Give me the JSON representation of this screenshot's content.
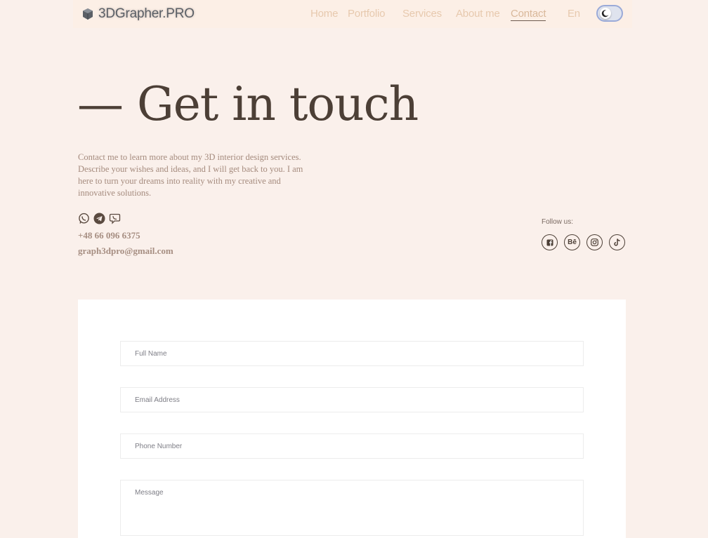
{
  "nav": {
    "brand": "3DGrapher.PRO",
    "links": [
      "Home",
      "Portfolio",
      "Services",
      "About me",
      "Contact"
    ],
    "active": "Contact",
    "language": "En"
  },
  "hero": {
    "title": "— Get in touch",
    "description": "Contact me to learn more about my 3D interior design services. Describe your wishes and ideas, and I will get back to you. I am here to turn your dreams into reality with my creative and innovative solutions."
  },
  "contact": {
    "messengers": [
      "whatsapp-icon",
      "telegram-icon",
      "viber-icon"
    ],
    "phone": "+48 66 096 6375",
    "email": "graph3dpro@gmail.com"
  },
  "follow": {
    "label": "Follow us:",
    "networks": [
      "facebook-icon",
      "behance-icon",
      "instagram-icon",
      "tiktok-icon"
    ],
    "behance_text": "Bē"
  },
  "form": {
    "full_name_placeholder": "Full Name",
    "email_placeholder": "Email Address",
    "phone_placeholder": "Phone Number",
    "message_placeholder": "Message"
  },
  "colors": {
    "page_bg": "#faf0eb",
    "nav_bg": "#fcefe6",
    "heading": "#4c3f36",
    "body_text": "#a58b7e",
    "nav_link": "#e7c9ae",
    "card_bg": "#ffffff"
  }
}
